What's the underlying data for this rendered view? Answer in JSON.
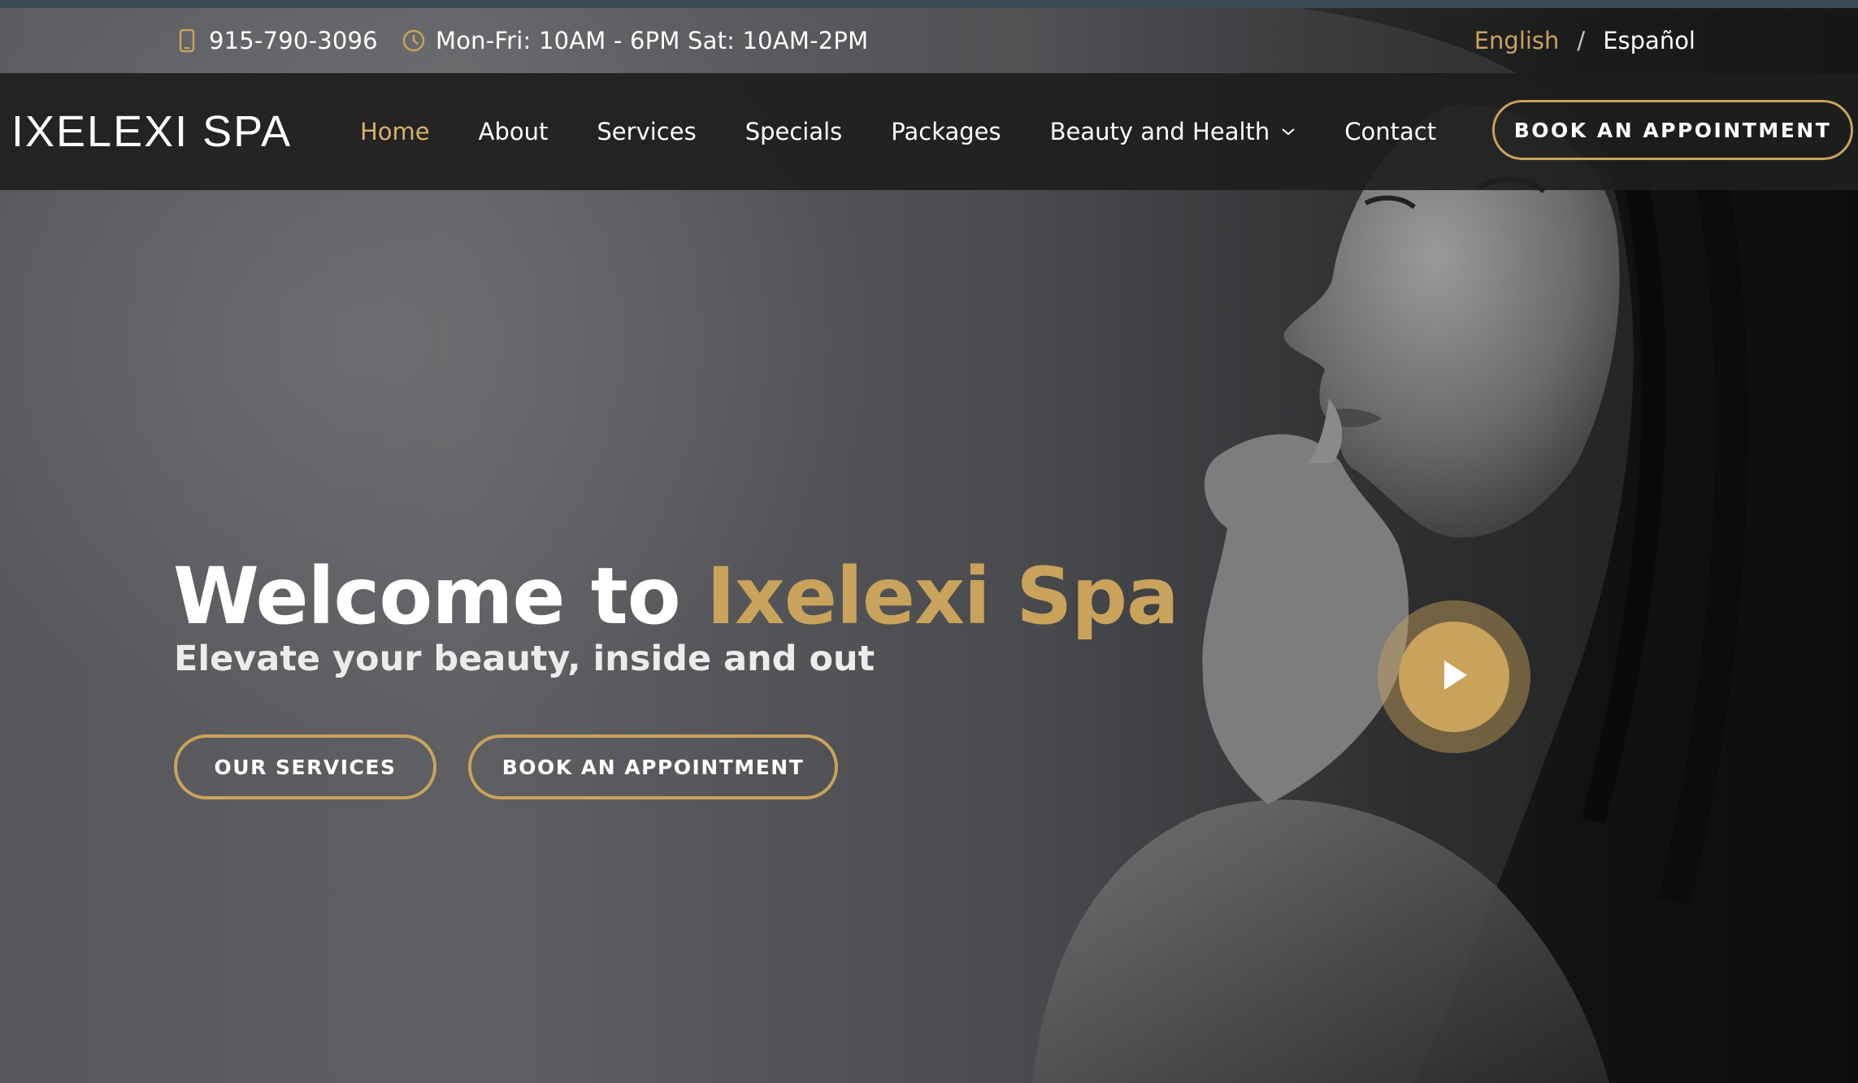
{
  "topbar": {
    "phone": "915-790-3096",
    "hours": "Mon-Fri: 10AM - 6PM Sat: 10AM-2PM",
    "phone_icon": "mobile-phone-icon",
    "hours_icon": "clock-icon",
    "lang_english": "English",
    "lang_separator": "/",
    "lang_spanish": "Español"
  },
  "navbar": {
    "logo": "IXELEXI SPA",
    "items": [
      {
        "label": "Home",
        "active": true
      },
      {
        "label": "About"
      },
      {
        "label": "Services"
      },
      {
        "label": "Specials"
      },
      {
        "label": "Packages"
      },
      {
        "label": "Beauty and Health",
        "dropdown": true
      },
      {
        "label": "Contact"
      }
    ],
    "book_label": "BOOK AN APPOINTMENT"
  },
  "hero": {
    "title_prefix": "Welcome to",
    "title_accent": "Ixelexi Spa",
    "subtitle": "Elevate your beauty, inside and out",
    "btn_services": "OUR SERVICES",
    "btn_book": "BOOK AN APPOINTMENT",
    "play_icon": "play-icon"
  },
  "colors": {
    "accent": "#c9a35b",
    "nav_bg": "#1e1e1e",
    "text": "#ffffff"
  }
}
